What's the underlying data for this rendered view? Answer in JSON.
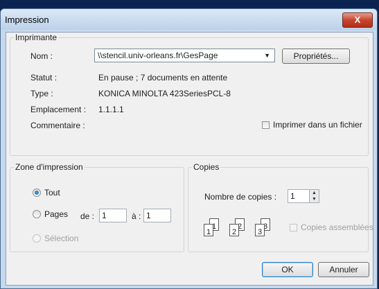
{
  "window": {
    "title": "Impression",
    "close_label": "X"
  },
  "printer": {
    "group_label": "Imprimante",
    "name_label": "Nom :",
    "name_value": "\\\\stencil.univ-orleans.fr\\GesPage",
    "properties_button": "Propriétés...",
    "status_label": "Statut :",
    "status_value": "En pause ; 7 documents en attente",
    "type_label": "Type :",
    "type_value": "KONICA MINOLTA 423SeriesPCL-8",
    "location_label": "Emplacement :",
    "location_value": "1.1.1.1",
    "comment_label": "Commentaire :",
    "print_to_file_label": "Imprimer dans un fichier"
  },
  "print_range": {
    "group_label": "Zone d'impression",
    "all_label": "Tout",
    "pages_label": "Pages",
    "from_label": "de :",
    "from_value": "1",
    "to_label": "à :",
    "to_value": "1",
    "selection_label": "Sélection",
    "selected_option": "all"
  },
  "copies": {
    "group_label": "Copies",
    "count_label": "Nombre de copies :",
    "count_value": "1",
    "collate_label": "Copies assemblées",
    "collate_icon_digits": [
      "1",
      "1",
      "2",
      "2",
      "3",
      "3"
    ]
  },
  "buttons": {
    "ok": "OK",
    "cancel": "Annuler"
  }
}
